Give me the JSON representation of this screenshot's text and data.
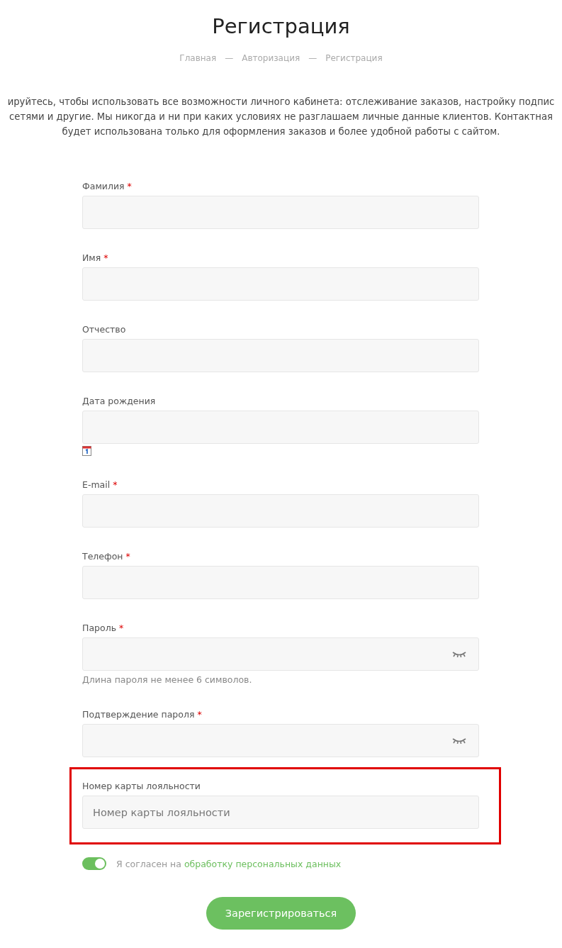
{
  "title": "Регистрация",
  "breadcrumbs": [
    {
      "label": "Главная"
    },
    {
      "label": "Авторизация"
    },
    {
      "label": "Регистрация"
    }
  ],
  "breadcrumb_separator": "—",
  "intro_lines": [
    "ируйтесь, чтобы использовать все возможности личного кабинета: отслеживание заказов, настройку подпис",
    "сетями и другие. Мы никогда и ни при каких условиях не разглашаем личные данные клиентов. Контактная",
    "будет использована только для оформления заказов и более удобной работы с сайтом."
  ],
  "fields": [
    {
      "kind": "text",
      "label": "Фамилия",
      "required": true,
      "highlighted": false
    },
    {
      "kind": "text",
      "label": "Имя",
      "required": true,
      "highlighted": false
    },
    {
      "kind": "text",
      "label": "Отчество",
      "required": false,
      "highlighted": false
    },
    {
      "kind": "date",
      "label": "Дата рождения",
      "required": false,
      "highlighted": false
    },
    {
      "kind": "text",
      "label": "E-mail",
      "required": true,
      "highlighted": false
    },
    {
      "kind": "text",
      "label": "Телефон",
      "required": true,
      "highlighted": false
    },
    {
      "kind": "password",
      "label": "Пароль",
      "required": true,
      "hint": "Длина пароля не менее 6 символов.",
      "highlighted": false
    },
    {
      "kind": "password",
      "label": "Подтверждение пароля",
      "required": true,
      "highlighted": false
    },
    {
      "kind": "text",
      "label": "Номер карты лояльности",
      "required": false,
      "placeholder": "Номер карты лояльности",
      "highlighted": true
    }
  ],
  "required_mark": "*",
  "consent": {
    "on": true,
    "text": "Я согласен на",
    "link": "обработку персональных данных"
  },
  "submit": "Зарегистрироваться"
}
